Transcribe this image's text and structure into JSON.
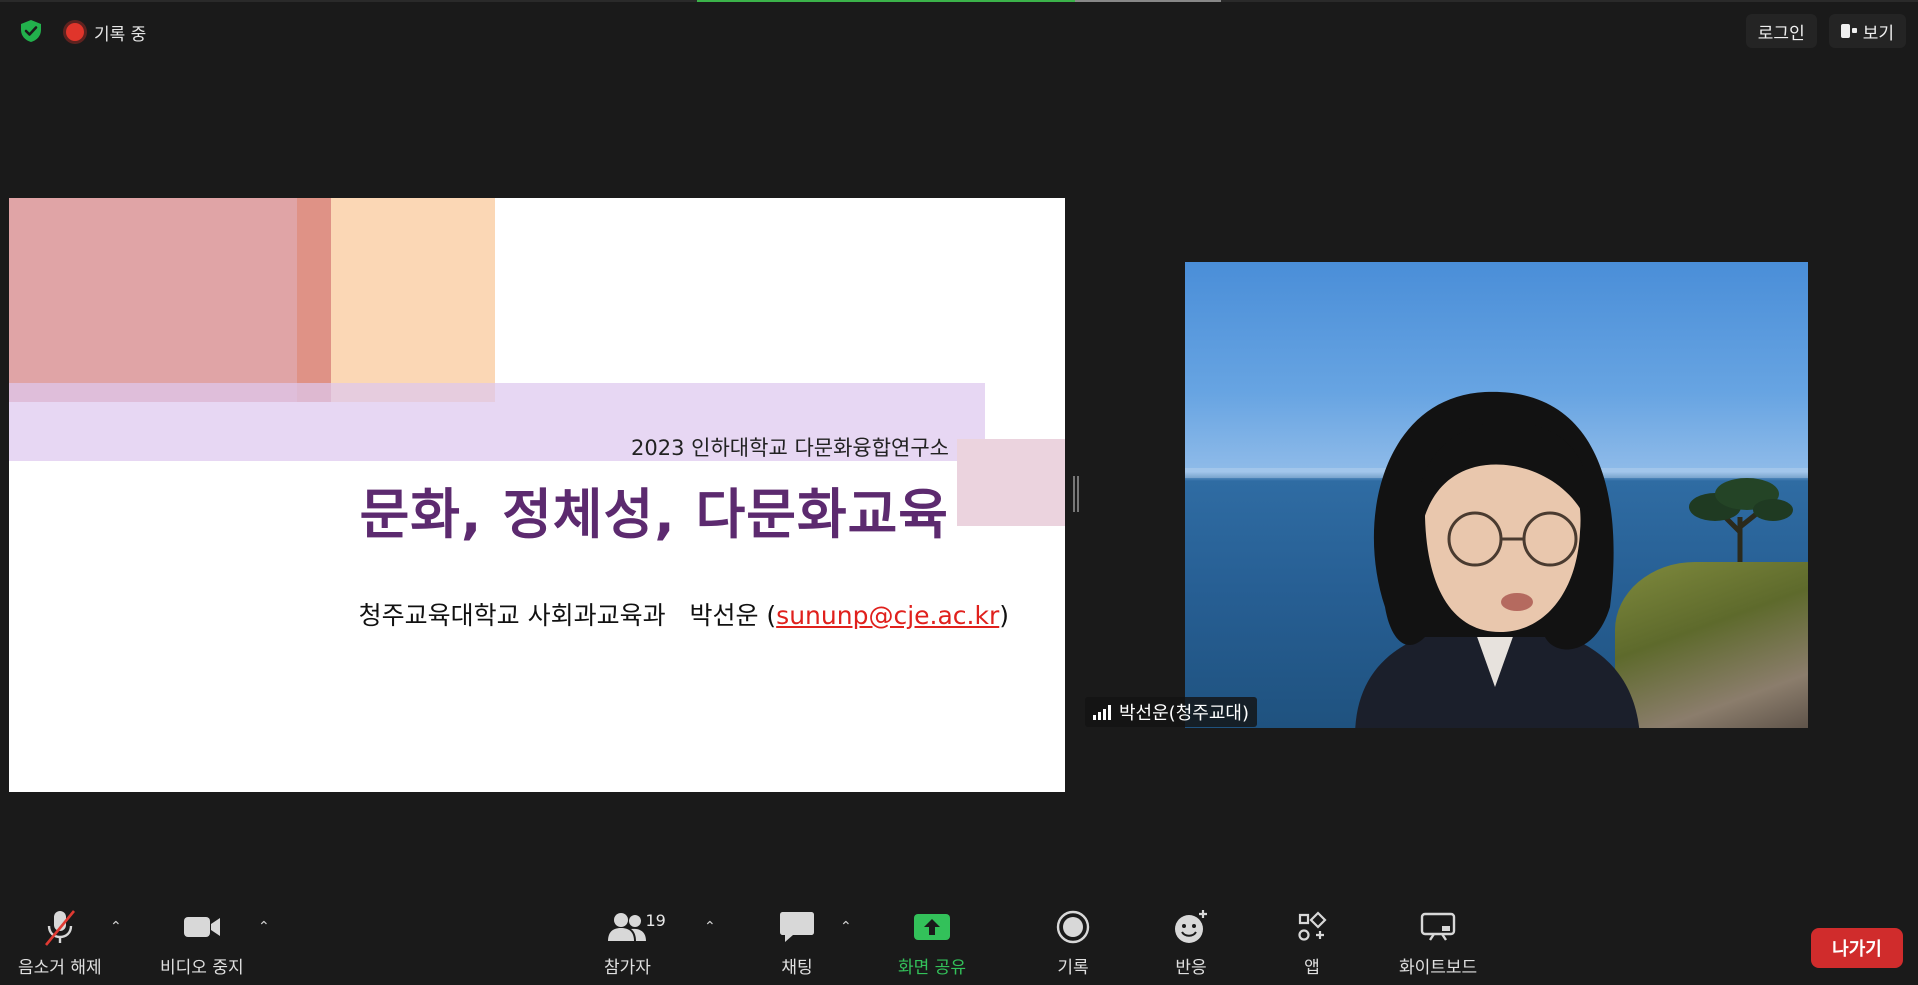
{
  "topbar": {
    "recording_label": "기록 중",
    "signin_label": "로그인",
    "view_label": "보기"
  },
  "slide": {
    "subtitle": "2023 인하대학교 다문화융합연구소",
    "title": "문화, 정체성, 다문화교육",
    "author": "청주교육대학교 사회과교육과   박선운 (",
    "email": "sununp@cje.ac.kr",
    "author_close": ")"
  },
  "participant": {
    "name": "박선운(청주교대)"
  },
  "toolbar": {
    "mute_label": "음소거 해제",
    "video_label": "비디오 중지",
    "participants_label": "참가자",
    "participants_count": "19",
    "chat_label": "채팅",
    "share_label": "화면 공유",
    "record_label": "기록",
    "reactions_label": "반응",
    "apps_label": "앱",
    "whiteboard_label": "화이트보드",
    "leave_label": "나가기"
  },
  "colors": {
    "background": "#1a1a1a",
    "share_green": "#33c15a",
    "leave_red": "#d02c2c",
    "slide_title_purple": "#5c2a6f",
    "email_red": "#e0201c"
  },
  "icons": [
    "shield-check-icon",
    "recording-dot-icon",
    "view-icon",
    "mic-muted-icon",
    "video-camera-icon",
    "participants-icon",
    "chat-icon",
    "share-screen-icon",
    "record-icon",
    "reactions-icon",
    "apps-icon",
    "whiteboard-icon",
    "signal-bars-icon",
    "chevron-up-icon"
  ]
}
